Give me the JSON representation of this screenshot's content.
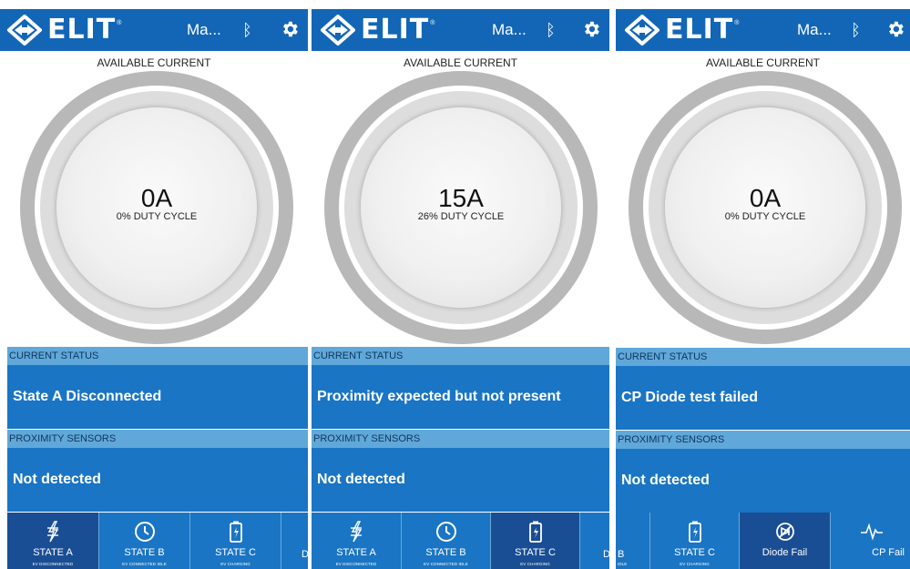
{
  "app": {
    "logo_text": "ELIT",
    "logo_mark": "®",
    "colors": {
      "header": "#1366b6",
      "section_header": "#5fa8d9",
      "section_body": "#1a75c4",
      "nav_active": "#1a4e94"
    },
    "icons": [
      "elit-logo-icon",
      "bluetooth-icon",
      "gear-icon",
      "lightning-icon",
      "clock-icon",
      "battery-charging-icon",
      "diode-icon",
      "pulse-icon"
    ]
  },
  "panels": [
    {
      "device_name": "Ma...",
      "available_label": "AVAILABLE CURRENT",
      "amps": "0A",
      "duty": "0% DUTY CYCLE",
      "current_status_label": "CURRENT STATUS",
      "current_status": "State A Disconnected",
      "proximity_label": "PROXIMITY SENSORS",
      "proximity": "Not detected",
      "nav": [
        {
          "label": "STATE A",
          "sub": "EV DISCONNECTED",
          "icon": "lightning-icon",
          "active": true
        },
        {
          "label": "STATE B",
          "sub": "EV CONNECTED IDLE",
          "icon": "clock-icon",
          "active": false
        },
        {
          "label": "STATE C",
          "sub": "EV CHARGING",
          "icon": "battery-charging-icon",
          "active": false
        }
      ],
      "nav_fragment": "D"
    },
    {
      "device_name": "Ma...",
      "available_label": "AVAILABLE CURRENT",
      "amps": "15A",
      "duty": "26% DUTY CYCLE",
      "current_status_label": "CURRENT STATUS",
      "current_status": "Proximity expected but not present",
      "proximity_label": "PROXIMITY SENSORS",
      "proximity": "Not detected",
      "nav": [
        {
          "label": "STATE A",
          "sub": "EV DISCONNECTED",
          "icon": "lightning-icon",
          "active": false
        },
        {
          "label": "STATE B",
          "sub": "EV CONNECTED IDLE",
          "icon": "clock-icon",
          "active": false
        },
        {
          "label": "STATE C",
          "sub": "EV CHARGING",
          "icon": "battery-charging-icon",
          "active": true
        }
      ],
      "nav_fragment": "D"
    },
    {
      "device_name": "Ma...",
      "available_label": "AVAILABLE CURRENT",
      "amps": "0A",
      "duty": "0% DUTY CYCLE",
      "current_status_label": "CURRENT STATUS",
      "current_status": "CP Diode test failed",
      "proximity_label": "PROXIMITY SENSORS",
      "proximity": "Not detected",
      "nav_fragment": "B",
      "nav_fragment_sub": "IDLE",
      "nav": [
        {
          "label": "STATE C",
          "sub": "EV CHARGING",
          "icon": "battery-charging-icon",
          "active": false
        },
        {
          "label": "Diode Fail",
          "sub": "",
          "icon": "diode-icon",
          "active": true
        },
        {
          "label": "CP Fail",
          "sub": "",
          "icon": "pulse-icon",
          "active": false
        }
      ]
    }
  ]
}
